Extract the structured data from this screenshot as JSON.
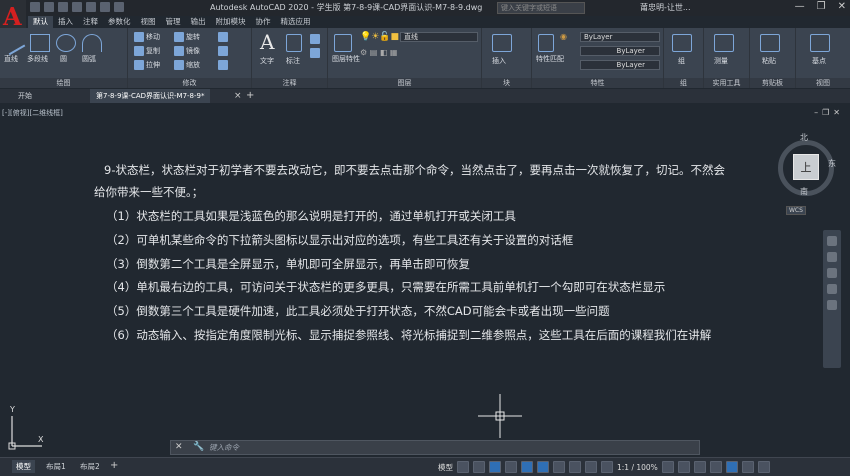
{
  "app": {
    "title": "Autodesk AutoCAD 2020 - 学生版    第7-8-9课-CAD界面认识-M7-8-9.dwg",
    "search_placeholder": "键入关键字或短语",
    "user": "莆忠明-让世..."
  },
  "menu_tabs": [
    "默认",
    "插入",
    "注释",
    "参数化",
    "视图",
    "管理",
    "输出",
    "附加模块",
    "协作",
    "精选应用"
  ],
  "ribbon": {
    "panels": {
      "draw": {
        "label": "绘图",
        "tools": [
          "直线",
          "多段线",
          "圆",
          "圆弧"
        ]
      },
      "modify": {
        "label": "修改",
        "tools": [
          "移动",
          "旋转",
          "复制",
          "镜像",
          "拉伸",
          "缩放"
        ]
      },
      "annotation": {
        "label": "注释",
        "tools": [
          "文字",
          "标注"
        ]
      },
      "layers": {
        "label": "图层",
        "tools": [
          "图层特性"
        ],
        "layer_value": "直线"
      },
      "block": {
        "label": "块",
        "tools": [
          "插入"
        ]
      },
      "properties": {
        "label": "特性",
        "tools": [
          "特性匹配"
        ],
        "color": "ByLayer",
        "linetype": "ByLayer",
        "lineweight": "ByLayer"
      },
      "groups": {
        "label": "组",
        "tools": [
          "组"
        ]
      },
      "utilities": {
        "label": "实用工具",
        "tools": [
          "测量"
        ]
      },
      "clipboard": {
        "label": "剪贴板",
        "tools": [
          "粘贴"
        ]
      },
      "view": {
        "label": "视图",
        "tools": [
          "基点"
        ]
      }
    }
  },
  "doc_tabs": {
    "start": "开始",
    "active": "第7-8-9课-CAD界面认识-M7-8-9*"
  },
  "viewport": {
    "label": "[-][俯视][二维线框]",
    "viewcube": {
      "face": "上",
      "north": "北",
      "south": "南",
      "east": "东"
    },
    "wcs": "WCS"
  },
  "content": {
    "lines": [
      "9-状态栏，状态栏对于初学者不要去改动它，即不要去点击那个命令，当然点击了，要再点击一次就恢复了，切记。不然会",
      "给你带来一些不便。；",
      "（1）状态栏的工具如果是浅蓝色的那么说明是打开的，通过单机打开或关闭工具",
      "（2）可单机某些命令的下拉箭头图标以显示出对应的选项，有些工具还有关于设置的对话框",
      "（3）倒数第二个工具是全屏显示，单机即可全屏显示，再单击即可恢复",
      "（4）单机最右边的工具，可访问关于状态栏的更多更具，只需要在所需工具前单机打一个勾即可在状态栏显示",
      "（5）倒数第三个工具是硬件加速，此工具必须处于打开状态，不然CAD可能会卡或者出现一些问题",
      "（6）动态输入、按指定角度限制光标、显示捕捉参照线、将光标捕捉到二维参照点，这些工具在后面的课程我们在讲解"
    ]
  },
  "command_line": {
    "placeholder": "键入命令"
  },
  "status_bar": {
    "tabs": [
      "模型",
      "布局1",
      "布局2"
    ],
    "model_label": "模型",
    "scale": "1:1 / 100%"
  }
}
